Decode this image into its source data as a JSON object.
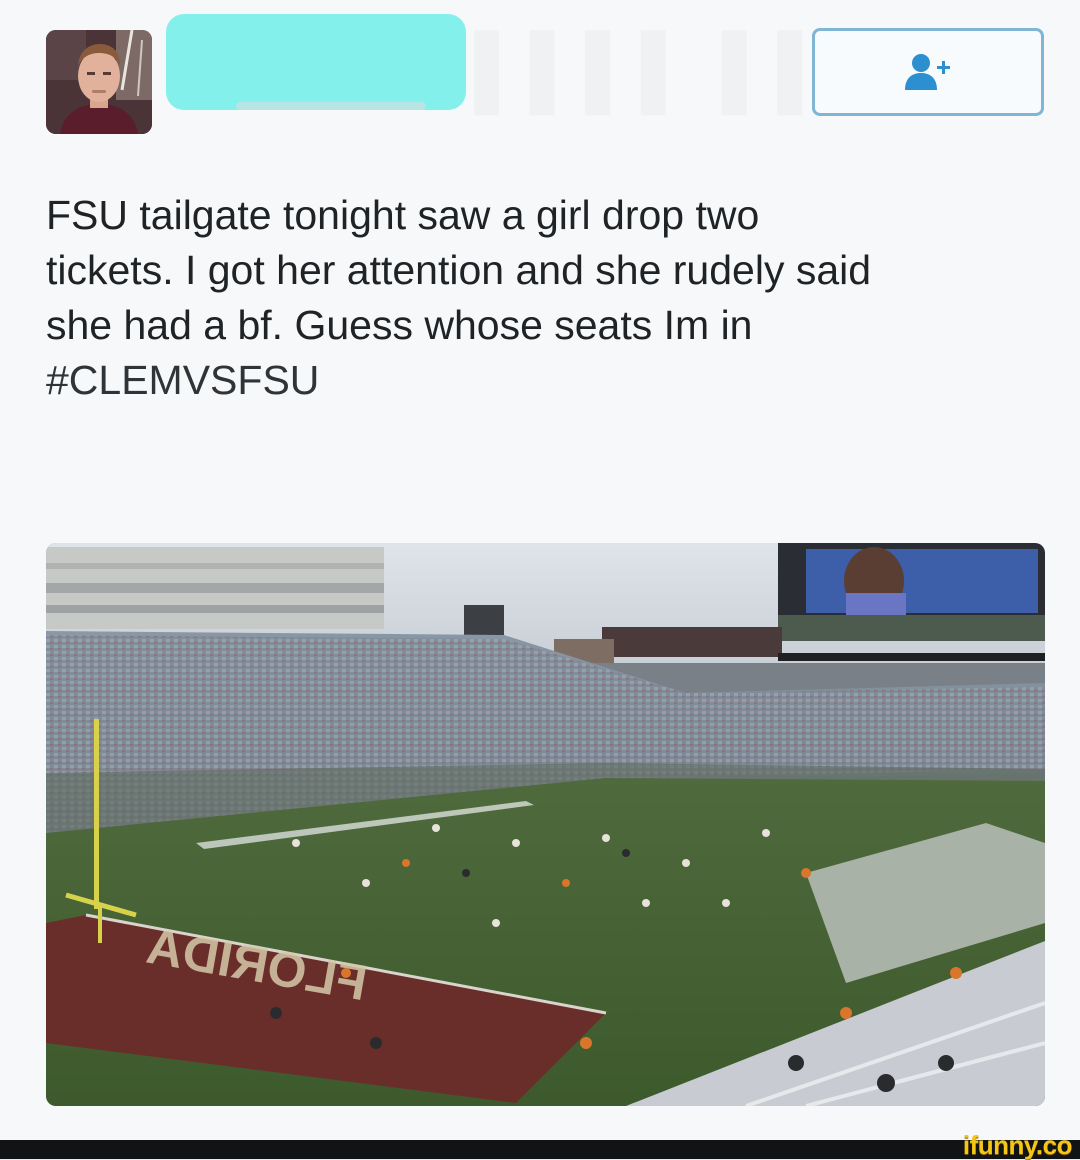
{
  "colors": {
    "redaction": "#84f0ec",
    "follow_border": "#7fb6d6",
    "follow_icon": "#2b8fd0",
    "text": "#1f2326",
    "watermark": "#f5c518",
    "card_bg": "#f7f8f9"
  },
  "header": {
    "avatar_icon": "user-avatar",
    "follow_icon": "add-user-icon"
  },
  "tweet": {
    "lines": [
      "FSU tailgate tonight saw a girl drop two",
      "tickets. I got her attention and she rudely said",
      "she had a bf. Guess whose seats Im in"
    ],
    "hashtag": "#CLEMVSFSU"
  },
  "photo": {
    "endzone_text": "FLORIDA"
  },
  "watermark": {
    "text": "ifunny.co"
  }
}
